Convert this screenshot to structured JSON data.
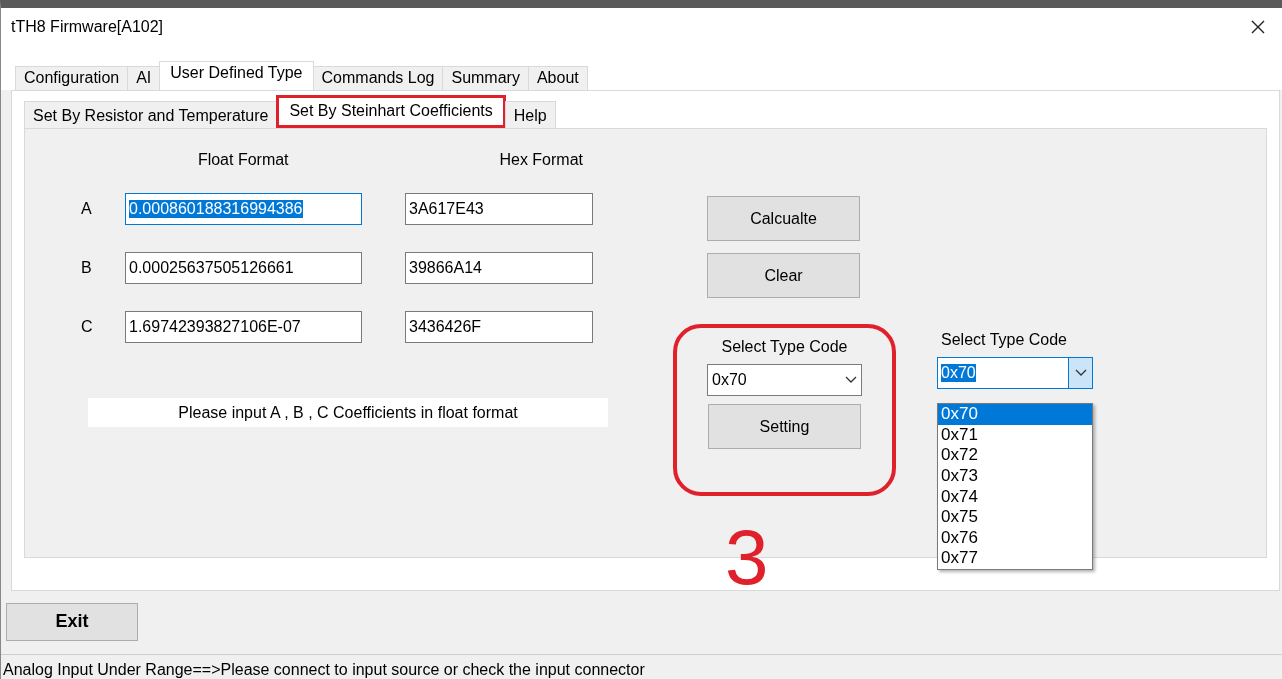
{
  "window": {
    "title": "tTH8 Firmware[A102]"
  },
  "tabs": [
    {
      "label": "Configuration",
      "selected": false
    },
    {
      "label": "AI",
      "selected": false
    },
    {
      "label": "User Defined Type",
      "selected": true
    },
    {
      "label": "Commands Log",
      "selected": false
    },
    {
      "label": "Summary",
      "selected": false
    },
    {
      "label": "About",
      "selected": false
    }
  ],
  "subtabs": [
    {
      "label": "Set By Resistor and Temperature",
      "selected": false,
      "annotated": false
    },
    {
      "label": "Set By Steinhart Coefficients",
      "selected": true,
      "annotated": true
    },
    {
      "label": "Help",
      "selected": false,
      "annotated": false
    }
  ],
  "columns": [
    "Float Format",
    "Hex Format"
  ],
  "coefficients": [
    {
      "label": "A",
      "float": "0.000860188316994386",
      "hex": "3A617E43",
      "float_selected": true
    },
    {
      "label": "B",
      "float": "0.00025637505126661",
      "hex": "39866A14",
      "float_selected": false
    },
    {
      "label": "C",
      "float": "1.69742393827106E-07",
      "hex": "3436426F",
      "float_selected": false
    }
  ],
  "note": "Please input A , B , C Coefficients in float format",
  "buttons": [
    "Calcualte",
    "Clear"
  ],
  "type_group": {
    "label": "Select Type Code",
    "value": "0x70",
    "button": "Setting",
    "annotated": true
  },
  "type_dropdown": {
    "label": "Select Type Code",
    "value": "0x70",
    "expanded": true,
    "options": [
      {
        "label": "0x70",
        "selected": true
      },
      {
        "label": "0x71",
        "selected": false
      },
      {
        "label": "0x72",
        "selected": false
      },
      {
        "label": "0x73",
        "selected": false
      },
      {
        "label": "0x74",
        "selected": false
      },
      {
        "label": "0x75",
        "selected": false
      },
      {
        "label": "0x76",
        "selected": false
      },
      {
        "label": "0x77",
        "selected": false
      }
    ]
  },
  "annotation_number": "3",
  "exit_button": "Exit",
  "status_bar": "Analog Input Under Range==>Please connect to input source or check the input connector"
}
